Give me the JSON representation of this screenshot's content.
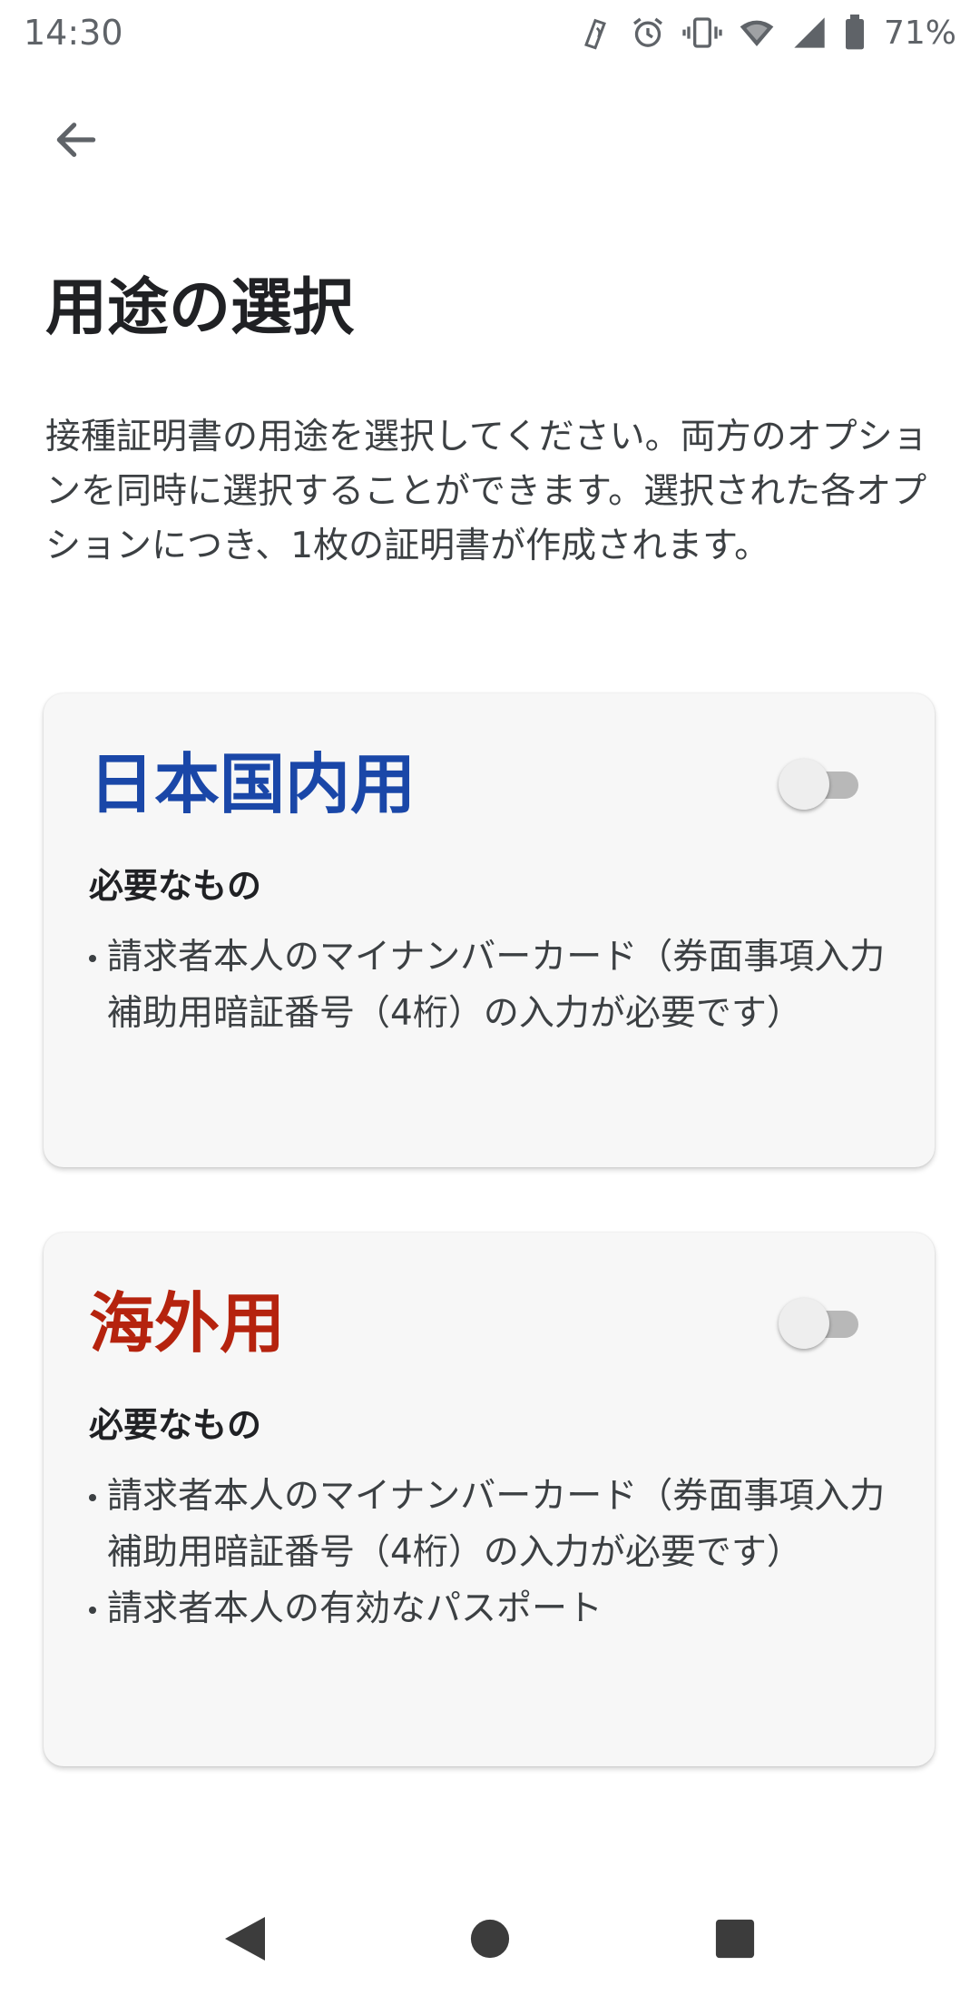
{
  "status_bar": {
    "time": "14:30",
    "battery_percent": "71%",
    "icons": [
      "nfc-icon",
      "alarm-icon",
      "vibrate-icon",
      "wifi-icon",
      "signal-icon",
      "battery-icon"
    ]
  },
  "header": {
    "back_icon": "arrow-back-icon",
    "title": "用途の選択"
  },
  "description": "接種証明書の用途を選択してください。両方のオプションを同時に選択することができます。選択された各オプションにつき、1枚の証明書が作成されます。",
  "cards": [
    {
      "title": "日本国内用",
      "title_color": "#1a47a8",
      "toggle_on": false,
      "requirements_heading": "必要なもの",
      "requirements": [
        "請求者本人のマイナンバーカード（券面事項入力補助用暗証番号（4桁）の入力が必要です）"
      ]
    },
    {
      "title": "海外用",
      "title_color": "#b5230e",
      "toggle_on": false,
      "requirements_heading": "必要なもの",
      "requirements": [
        "請求者本人のマイナンバーカード（券面事項入力補助用暗証番号（4桁）の入力が必要です）",
        "請求者本人の有効なパスポート"
      ]
    }
  ],
  "nav_bar": {
    "icons": [
      "nav-back-icon",
      "nav-home-icon",
      "nav-recents-icon"
    ]
  }
}
